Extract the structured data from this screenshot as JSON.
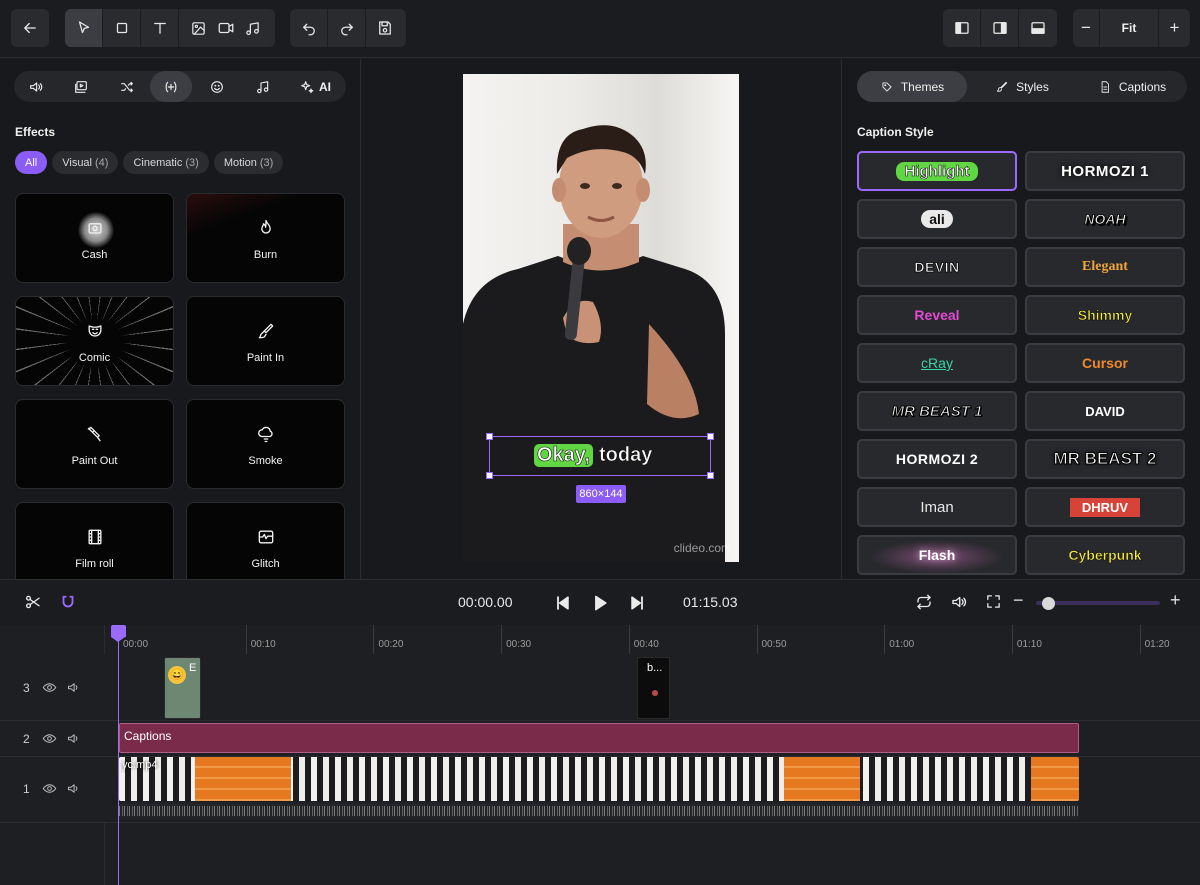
{
  "toolbar": {
    "back_icon": "arrow-left-icon",
    "tools": [
      "pointer-icon",
      "square-icon",
      "text-icon",
      "image-icon",
      "video-icon",
      "music-icon"
    ],
    "history": [
      "undo-icon",
      "redo-icon",
      "save-icon"
    ],
    "layouts": [
      "layout-left-icon",
      "layout-right-icon",
      "layout-bottom-icon"
    ],
    "zoom": {
      "minus": "−",
      "value": "Fit",
      "plus": "+"
    }
  },
  "left_panel": {
    "category_tabs": [
      {
        "icon": "volume-icon",
        "label": ""
      },
      {
        "icon": "media-icon",
        "label": ""
      },
      {
        "icon": "shuffle-icon",
        "label": ""
      },
      {
        "icon": "effects-icon",
        "label": ""
      },
      {
        "icon": "smiley-icon",
        "label": ""
      },
      {
        "icon": "music-note-icon",
        "label": ""
      },
      {
        "icon": "sparkle-icon",
        "label": "AI"
      }
    ],
    "section_title": "Effects",
    "filters": [
      {
        "label": "All",
        "count": ""
      },
      {
        "label": "Visual",
        "count": "(4)"
      },
      {
        "label": "Cinematic",
        "count": "(3)"
      },
      {
        "label": "Motion",
        "count": "(3)"
      }
    ],
    "effects": [
      "Cash",
      "Burn",
      "Comic",
      "Paint In",
      "Paint Out",
      "Smoke",
      "Film roll",
      "Glitch"
    ]
  },
  "preview": {
    "caption_word1": "Okay,",
    "caption_word2": "today",
    "size_badge": "860×144",
    "watermark": "clideo.com"
  },
  "right_panel": {
    "tabs": [
      {
        "icon": "themes-icon",
        "label": "Themes"
      },
      {
        "icon": "brush-icon",
        "label": "Styles"
      },
      {
        "icon": "document-icon",
        "label": "Captions"
      }
    ],
    "section_title": "Caption Style",
    "styles": [
      "Highlight",
      "HORMOZI 1",
      "ali",
      "NOAH",
      "DEVIN",
      "Elegant",
      "Reveal",
      "Shimmy",
      "cRay",
      "Cursor",
      "MR BEAST 1",
      "DAVID",
      "HORMOZI 2",
      "MR BEAST 2",
      "Iman",
      "DHRUV",
      "Flash",
      "Cyberpunk"
    ]
  },
  "transport": {
    "current_time": "00:00.00",
    "total_time": "01:15.03",
    "zoom_minus": "−",
    "zoom_plus": "+",
    "zoom_level": 0.05
  },
  "timeline": {
    "ruler": [
      "00:00",
      "00:10",
      "00:20",
      "00:30",
      "00:40",
      "00:50",
      "01:00",
      "01:10",
      "01:20"
    ],
    "tracks": [
      {
        "num": "3",
        "clips": [
          {
            "label": "E"
          },
          {
            "label": "b..."
          }
        ]
      },
      {
        "num": "2",
        "clips": [
          {
            "label": "Captions"
          }
        ]
      },
      {
        "num": "1",
        "clips": [
          {
            "label": "yc.mp4"
          }
        ]
      }
    ]
  },
  "colors": {
    "accent": "#8b5cf6",
    "caption_track": "#7a2b49",
    "highlight_green": "#5fd642"
  }
}
